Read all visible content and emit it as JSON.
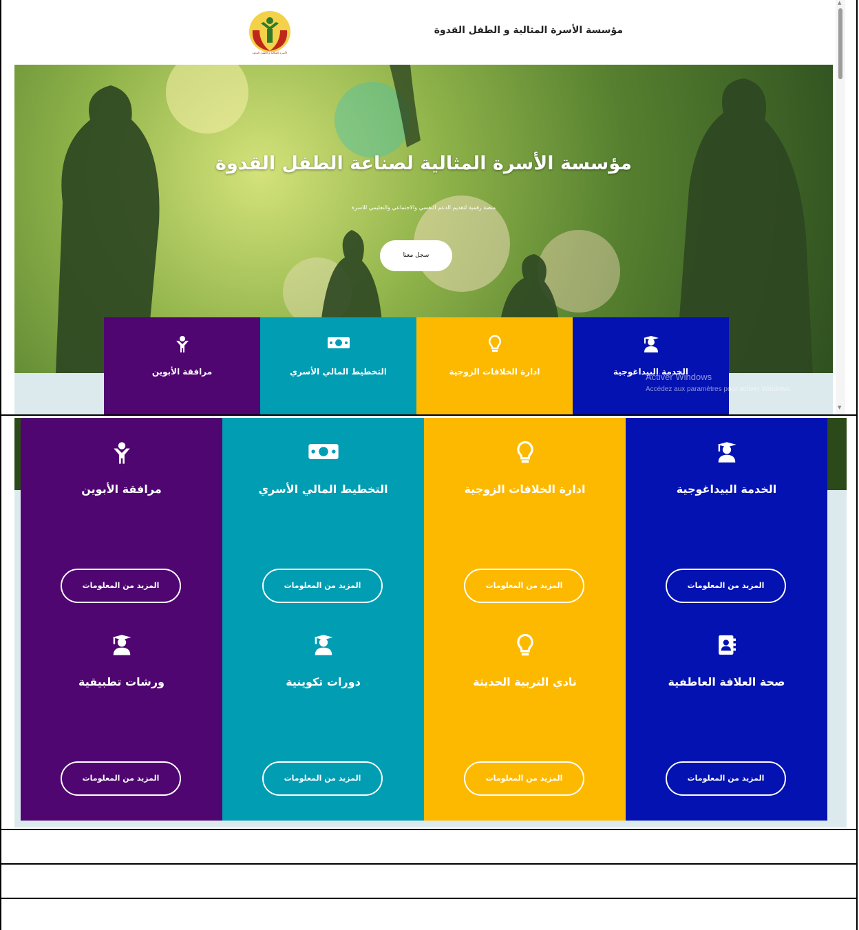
{
  "header": {
    "site_title": "مؤسسة الأسرة المثالية و الطفل القدوة",
    "logo_caption": "الأسرة المثالية و الطفل القدوة"
  },
  "hero": {
    "title": "مؤسسة الأسرة المثالية لصناعة الطفل القدوة",
    "subtitle": "منصة رقمية لتقديم الدعم النفسي والاجتماعي والتعليمي للاسرة",
    "cta_label": "سجل معنا"
  },
  "services_strip": [
    {
      "label": "مرافقة الأبوين",
      "icon": "child-icon",
      "color": "#4f0670"
    },
    {
      "label": "التخطيط المالي الأسري",
      "icon": "money-bill-icon",
      "color": "#009db3"
    },
    {
      "label": "ادارة الخلافات الزوجية",
      "icon": "lightbulb-icon",
      "color": "#fdb900"
    },
    {
      "label": "الخدمة البيداغوجية",
      "icon": "graduate-icon",
      "color": "#0312b0"
    }
  ],
  "watermark": {
    "line1": "Activer Windows",
    "line2": "Accédez aux paramètres pour activer Windows."
  },
  "services_grid": {
    "columns": [
      {
        "color": "#4f0670",
        "items": [
          {
            "label": "مرافقة الأبوين",
            "icon": "child-icon",
            "button": "المزيد من المعلومات"
          },
          {
            "label": "ورشات تطبيقية",
            "icon": "graduate-icon",
            "button": "المزيد من المعلومات"
          }
        ]
      },
      {
        "color": "#009db3",
        "items": [
          {
            "label": "التخطيط المالي الأسري",
            "icon": "money-bill-icon",
            "button": "المزيد من المعلومات"
          },
          {
            "label": "دورات تكوينية",
            "icon": "graduate-icon",
            "button": "المزيد من المعلومات"
          }
        ]
      },
      {
        "color": "#fdb900",
        "items": [
          {
            "label": "ادارة الخلافات الزوجية",
            "icon": "lightbulb-icon",
            "button": "المزيد من المعلومات"
          },
          {
            "label": "نادي التربية الحديثة",
            "icon": "lightbulb-icon",
            "button": "المزيد من المعلومات"
          }
        ]
      },
      {
        "color": "#0312b0",
        "items": [
          {
            "label": "الخدمة البيداغوجية",
            "icon": "graduate-icon",
            "button": "المزيد من المعلومات"
          },
          {
            "label": "صحة العلاقة العاطفية",
            "icon": "address-book-icon",
            "button": "المزيد من المعلومات"
          }
        ]
      }
    ]
  }
}
